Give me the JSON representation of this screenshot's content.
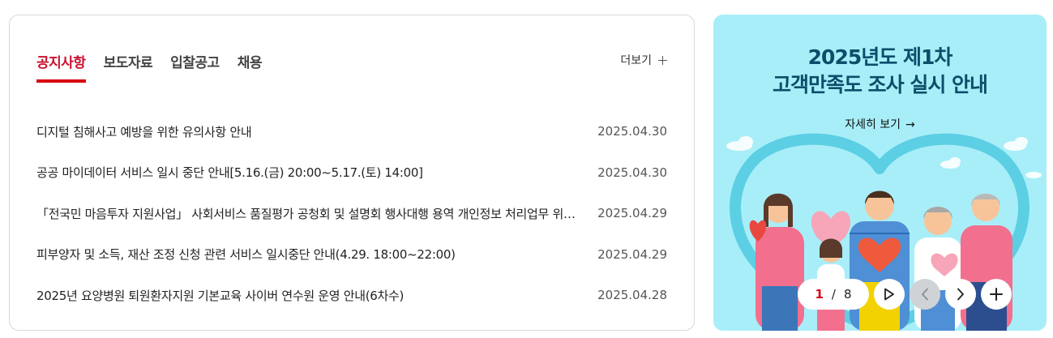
{
  "notice": {
    "tabs": [
      {
        "label": "공지사항",
        "active": true
      },
      {
        "label": "보도자료",
        "active": false
      },
      {
        "label": "입찰공고",
        "active": false
      },
      {
        "label": "채용",
        "active": false
      }
    ],
    "more_label": "더보기",
    "items": [
      {
        "title": "디지털 침해사고 예방을 위한 유의사항 안내",
        "date": "2025.04.30"
      },
      {
        "title": "공공 마이데이터 서비스 일시 중단 안내[5.16.(금) 20:00~5.17.(토) 14:00]",
        "date": "2025.04.30"
      },
      {
        "title": "「전국민 마음투자 지원사업」 사회서비스 품질평가 공청회 및 설명회 행사대행 용역 개인정보 처리업무 위탁 안내",
        "date": "2025.04.29"
      },
      {
        "title": "피부양자 및 소득, 재산 조정 신청 관련 서비스 일시중단 안내(4.29. 18:00~22:00)",
        "date": "2025.04.29"
      },
      {
        "title": "2025년 요양병원 퇴원환자지원 기본교육 사이버 연수원 운영 안내(6차수)",
        "date": "2025.04.28"
      }
    ]
  },
  "banner": {
    "title_line1": "2025년도 제1차",
    "title_line2": "고객만족도 조사 실시 안내",
    "detail_label": "자세히 보기",
    "background_color": "#a8eef8",
    "pager": {
      "current": "1",
      "separator": "/",
      "total": "8"
    },
    "icons": {
      "play": "play-icon",
      "prev": "chevron-left-icon",
      "next": "chevron-right-icon",
      "more": "plus-icon"
    }
  },
  "colors": {
    "accent": "#d7000f",
    "banner_title": "#0b4e6a"
  }
}
